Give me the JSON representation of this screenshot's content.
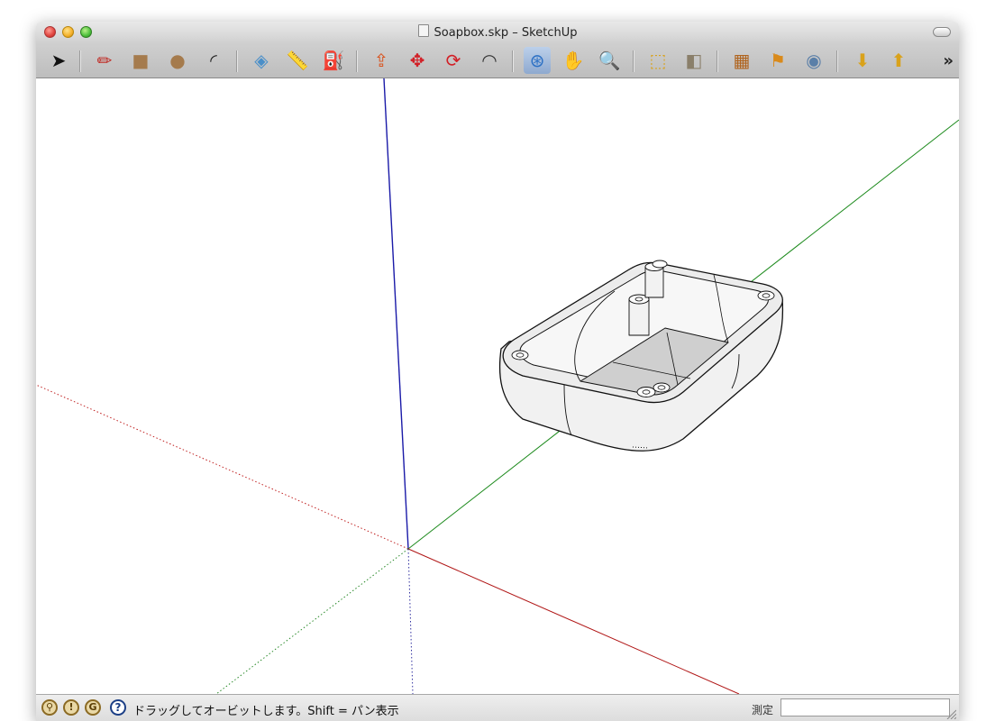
{
  "window": {
    "title": "Soapbox.skp – SketchUp"
  },
  "toolbar": {
    "tools": [
      {
        "name": "select-tool-button",
        "icon": "arrow-cursor-icon",
        "glyph": "➤",
        "color": "#111111"
      },
      {
        "name": "pencil-tool-button",
        "icon": "pencil-icon",
        "glyph": "✏",
        "color": "#c0261f"
      },
      {
        "name": "rectangle-tool-button",
        "icon": "rectangle-icon",
        "glyph": "■",
        "color": "#a57b4d"
      },
      {
        "name": "circle-tool-button",
        "icon": "circle-icon",
        "glyph": "●",
        "color": "#a57b4d"
      },
      {
        "name": "arc-tool-button",
        "icon": "arc-icon",
        "glyph": "◜",
        "color": "#222222"
      },
      {
        "name": "eraser-tool-button",
        "icon": "eraser-icon",
        "glyph": "◈",
        "color": "#4a8fc9"
      },
      {
        "name": "tape-measure-tool-button",
        "icon": "tape-measure-icon",
        "glyph": "📏",
        "color": "#d9a21b"
      },
      {
        "name": "paint-bucket-tool-button",
        "icon": "paint-bucket-icon",
        "glyph": "⛽",
        "color": "#c8a14a"
      },
      {
        "name": "push-pull-tool-button",
        "icon": "push-pull-icon",
        "glyph": "⇪",
        "color": "#d9531e"
      },
      {
        "name": "move-tool-button",
        "icon": "move-icon",
        "glyph": "✥",
        "color": "#d21f26"
      },
      {
        "name": "rotate-tool-button",
        "icon": "rotate-icon",
        "glyph": "⟳",
        "color": "#d21f26"
      },
      {
        "name": "offset-tool-button",
        "icon": "offset-icon",
        "glyph": "◠",
        "color": "#333333"
      },
      {
        "name": "orbit-tool-button",
        "icon": "orbit-icon",
        "glyph": "⊛",
        "color": "#2a6fc4",
        "active": true
      },
      {
        "name": "pan-tool-button",
        "icon": "hand-icon",
        "glyph": "✋",
        "color": "#444444"
      },
      {
        "name": "zoom-tool-button",
        "icon": "magnifier-icon",
        "glyph": "🔍",
        "color": "#222222"
      },
      {
        "name": "zoom-extents-button",
        "icon": "zoom-extents-icon",
        "glyph": "⬚",
        "color": "#d9a21b"
      },
      {
        "name": "previous-view-button",
        "icon": "previous-view-icon",
        "glyph": "◧",
        "color": "#8a7f6a"
      },
      {
        "name": "warehouse-button",
        "icon": "warehouse-icon",
        "glyph": "▦",
        "color": "#b0641e"
      },
      {
        "name": "place-model-button",
        "icon": "place-model-icon",
        "glyph": "⚑",
        "color": "#d98a1b"
      },
      {
        "name": "google-earth-button",
        "icon": "google-earth-icon",
        "glyph": "◉",
        "color": "#5a7fa8"
      },
      {
        "name": "get-models-button",
        "icon": "get-models-icon",
        "glyph": "⬇",
        "color": "#d9a21b"
      },
      {
        "name": "share-model-button",
        "icon": "share-model-icon",
        "glyph": "⬆",
        "color": "#d9a21b"
      }
    ],
    "more_label": "»"
  },
  "status": {
    "hint": "ドラッグしてオービットします。Shift = パン表示",
    "measurements_label": "測定",
    "measurements_value": ""
  }
}
